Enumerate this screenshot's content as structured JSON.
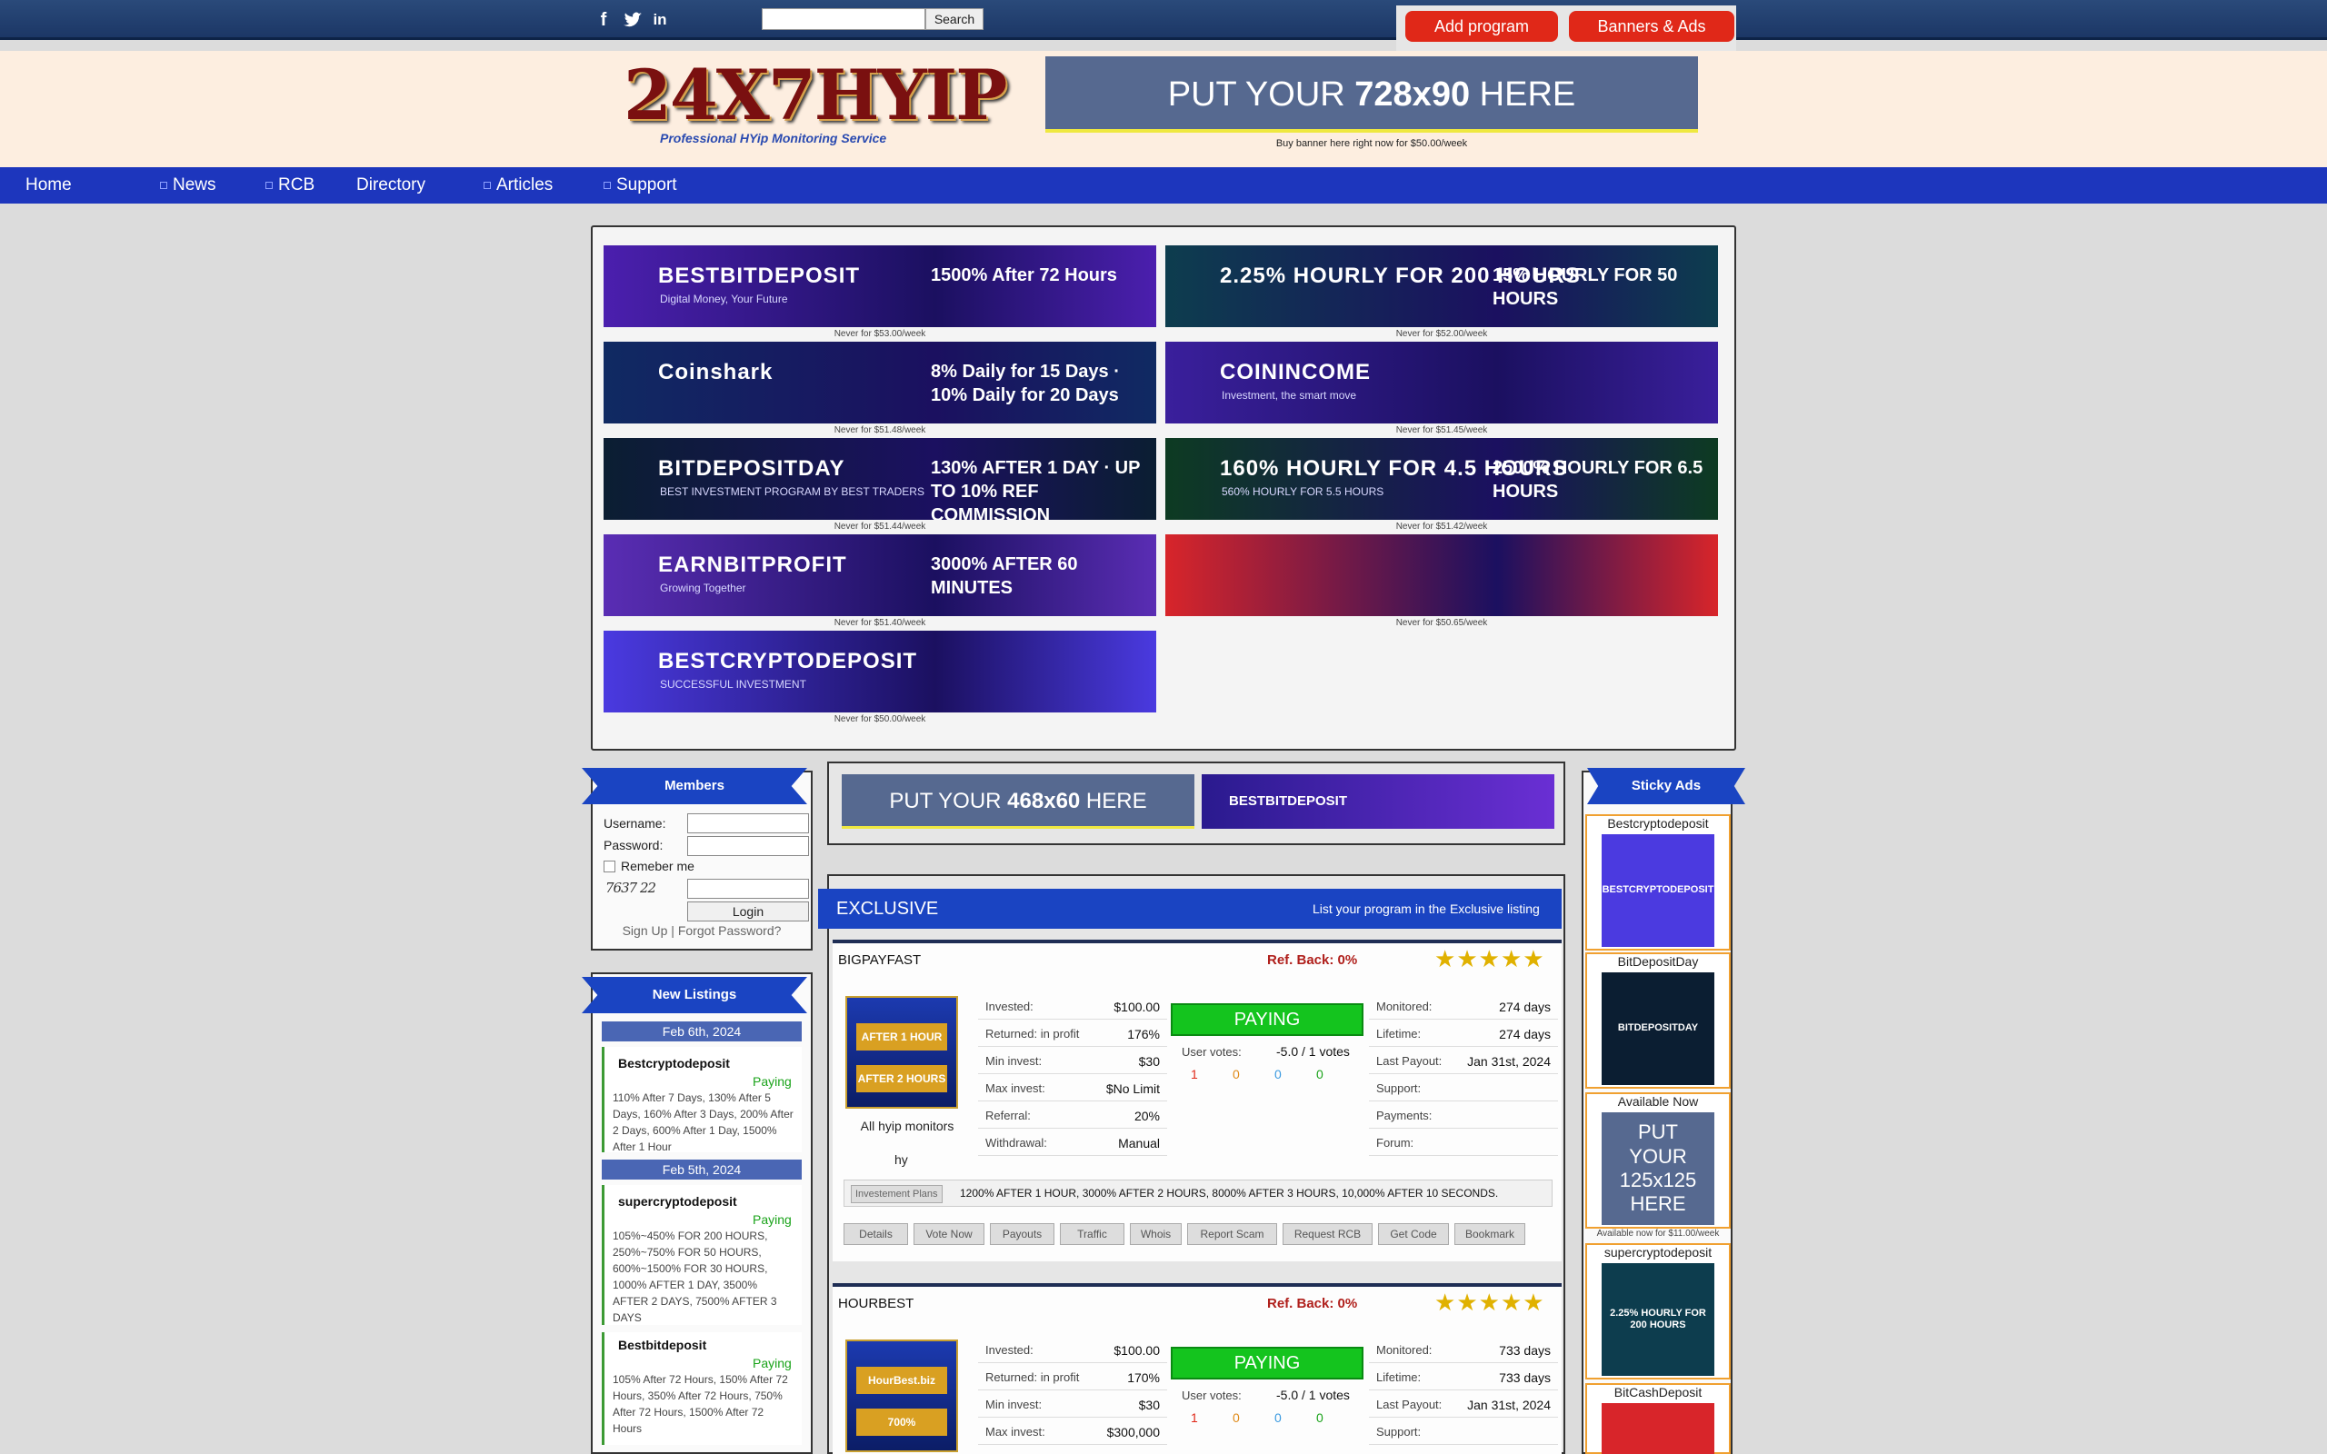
{
  "topbar": {
    "social": [
      {
        "name": "facebook-icon",
        "glyph": "f"
      },
      {
        "name": "twitter-icon",
        "glyph": "t"
      },
      {
        "name": "linkedin-icon",
        "glyph": "in"
      }
    ],
    "search_button": "Search",
    "add_program": "Add program",
    "banners_ads": "Banners & Ads"
  },
  "header": {
    "logo_text": "24X7HYIP",
    "logo_tagline": "Professional HYip Monitoring Service",
    "banner_prefix": "PUT YOUR ",
    "banner_size": "728x90",
    "banner_suffix": " HERE",
    "banner_buy": "Buy banner here right now for $50.00/week"
  },
  "nav": [
    "Home",
    "News",
    "RCB",
    "Directory",
    "Articles",
    "Support"
  ],
  "ads": [
    {
      "title": "BESTBITDEPOSIT",
      "sub": "Digital Money, Your Future",
      "promo": "1500% After 72 Hours",
      "caption": "Never for $53.00/week",
      "bg": "#4b1fae"
    },
    {
      "title": "2.25% HOURLY FOR 200 HOURS",
      "sub": "",
      "promo": "15% HOURLY FOR 50 HOURS",
      "caption": "Never for $52.00/week",
      "bg": "#0d3d4e"
    },
    {
      "title": "Coinshark",
      "sub": "",
      "promo": "8% Daily for 15 Days · 10% Daily for 20 Days",
      "caption": "Never for $51.48/week",
      "bg": "#102a62"
    },
    {
      "title": "COININCOME",
      "sub": "Investment, the smart move",
      "promo": "",
      "caption": "Never for $51.45/week",
      "bg": "#3a1f9c"
    },
    {
      "title": "BITDEPOSITDAY",
      "sub": "BEST INVESTMENT PROGRAM BY BEST TRADERS",
      "promo": "130% AFTER 1 DAY · UP TO 10% REF COMMISSION",
      "caption": "Never for $51.44/week",
      "bg": "#0b1e32"
    },
    {
      "title": "160% HOURLY FOR 4.5 HOURS",
      "sub": "560% HOURLY FOR 5.5 HOURS",
      "promo": "2500% HOURLY FOR 6.5 HOURS",
      "caption": "Never for $51.42/week",
      "bg": "#0d3b22"
    },
    {
      "title": "EARNBITPROFIT",
      "sub": "Growing Together",
      "promo": "3000% AFTER 60 MINUTES",
      "caption": "Never for $51.40/week",
      "bg": "#5a2db4"
    },
    {
      "title": "",
      "sub": "",
      "promo": "",
      "caption": "Never for $50.65/week",
      "bg": "#d8252a"
    },
    {
      "title": "BESTCRYPTODEPOSIT",
      "sub": "SUCCESSFUL INVESTMENT",
      "promo": "",
      "caption": "Never for $50.00/week",
      "bg": "#4a3ae0"
    }
  ],
  "members": {
    "title": "Members",
    "username": "Username:",
    "password": "Password:",
    "remember": "Remeber me",
    "captcha": "7637 22",
    "login": "Login",
    "signup": "Sign Up",
    "sep": " | ",
    "forgot": "Forgot Password?"
  },
  "new_listings": {
    "title": "New Listings",
    "groups": [
      {
        "date": "Feb 6th, 2024",
        "items": [
          {
            "name": "Bestcryptodeposit",
            "status": "Paying",
            "desc": "110% After 7 Days, 130% After 5 Days, 160% After 3 Days, 200% After 2 Days, 600% After 1 Day, 1500% After 1 Hour"
          }
        ]
      },
      {
        "date": "Feb 5th, 2024",
        "items": [
          {
            "name": "supercryptodeposit",
            "status": "Paying",
            "desc": "105%~450% FOR 200 HOURS, 250%~750% FOR 50 HOURS, 600%~1500% FOR 30 HOURS, 1000% AFTER 1 DAY, 3500% AFTER 2 DAYS, 7500% AFTER 3 DAYS"
          },
          {
            "name": "Bestbitdeposit",
            "status": "Paying",
            "desc": "105% After 72 Hours, 150% After 72 Hours, 350% After 72 Hours, 750% After 72 Hours, 1500% After 72 Hours"
          }
        ]
      }
    ]
  },
  "banner468": {
    "prefix": "PUT YOUR ",
    "size": "468x60",
    "suffix": " HERE",
    "ad_title": "BESTBITDEPOSIT"
  },
  "exclusive": {
    "title": "EXCLUSIVE",
    "link": "List your program in the Exclusive listing"
  },
  "programs": [
    {
      "name": "BIGPAYFAST",
      "refback": "Ref. Back: 0%",
      "thumb_text": [
        "AFTER 1 HOUR",
        "AFTER 2 HOURS"
      ],
      "monitors": "All hyip monitors",
      "monitors2": "hy",
      "left": [
        [
          "Invested:",
          "$100.00"
        ],
        [
          "Returned: in profit",
          "176%"
        ],
        [
          "Min invest:",
          "$30"
        ],
        [
          "Max invest:",
          "$No Limit"
        ],
        [
          "Referral:",
          "20%"
        ],
        [
          "Withdrawal:",
          "Manual"
        ]
      ],
      "status": "PAYING",
      "votes_label": "User votes:",
      "votes": "-5.0 / 1 votes",
      "vote_counts": [
        "1",
        "0",
        "0",
        "0"
      ],
      "right": [
        [
          "Monitored:",
          "274 days"
        ],
        [
          "Lifetime:",
          "274 days"
        ],
        [
          "Last Payout:",
          "Jan 31st, 2024"
        ],
        [
          "Support:",
          ""
        ],
        [
          "Payments:",
          ""
        ],
        [
          "Forum:",
          ""
        ]
      ],
      "plans_label": "Investement Plans",
      "plans": "1200% AFTER 1 HOUR, 3000% AFTER 2 HOURS, 8000% AFTER 3 HOURS, 10,000% AFTER 10 SECONDS.",
      "actions": [
        "Details",
        "Vote Now",
        "Payouts",
        "Traffic",
        "Whois",
        "Report Scam",
        "Request RCB",
        "Get Code",
        "Bookmark"
      ]
    },
    {
      "name": "HOURBEST",
      "refback": "Ref. Back: 0%",
      "thumb_text": [
        "HourBest.biz",
        "700%"
      ],
      "left": [
        [
          "Invested:",
          "$100.00"
        ],
        [
          "Returned: in profit",
          "170%"
        ],
        [
          "Min invest:",
          "$30"
        ],
        [
          "Max invest:",
          "$300,000"
        ]
      ],
      "status": "PAYING",
      "votes_label": "User votes:",
      "votes": "-5.0 / 1 votes",
      "vote_counts": [
        "1",
        "0",
        "0",
        "0"
      ],
      "right": [
        [
          "Monitored:",
          "733 days"
        ],
        [
          "Lifetime:",
          "733 days"
        ],
        [
          "Last Payout:",
          "Jan 31st, 2024"
        ],
        [
          "Support:",
          ""
        ]
      ]
    }
  ],
  "sticky": {
    "title": "Sticky Ads",
    "items": [
      {
        "name": "Bestcryptodeposit",
        "img_text": "BESTCRYPTODEPOSIT",
        "bg": "#4b3ae0"
      },
      {
        "name": "BitDepositDay",
        "img_text": "BITDEPOSITDAY",
        "bg": "#0b1e32"
      },
      {
        "name": "Available Now",
        "img_text": "PUT YOUR 125x125 HERE",
        "bg": "#566990",
        "caption": "Available now for $11.00/week"
      },
      {
        "name": "supercryptodeposit",
        "img_text": "2.25% HOURLY FOR 200 HOURS",
        "bg": "#0d3d4e"
      },
      {
        "name": "BitCashDeposit",
        "img_text": "",
        "bg": "#d8252a"
      }
    ]
  }
}
